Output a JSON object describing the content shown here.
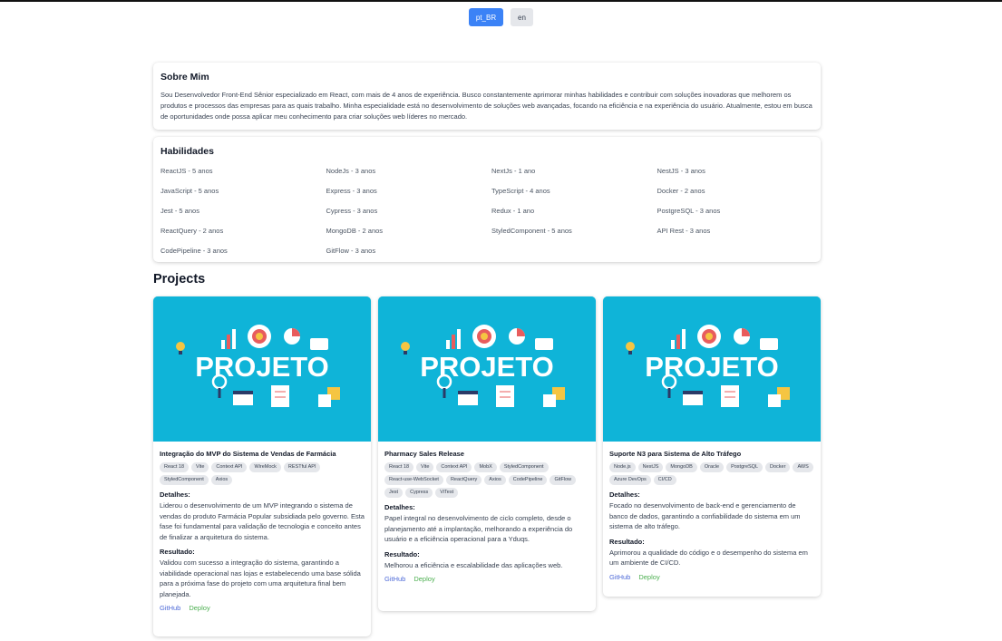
{
  "languages": [
    {
      "label": "pt_BR",
      "active": true
    },
    {
      "label": "en",
      "active": false
    }
  ],
  "about": {
    "title": "Sobre Mim",
    "text": "Sou Desenvolvedor Front-End Sênior especializado em React, com mais de 4 anos de experiência. Busco constantemente aprimorar minhas habilidades e contribuir com soluções inovadoras que melhorem os produtos e processos das empresas para as quais trabalho. Minha especialidade está no desenvolvimento de soluções web avançadas, focando na eficiência e na experiência do usuário. Atualmente, estou em busca de oportunidades onde possa aplicar meu conhecimento para criar soluções web líderes no mercado."
  },
  "skills": {
    "title": "Habilidades",
    "items": [
      "ReactJS - 5 anos",
      "NodeJs - 3 anos",
      "NextJs - 1 ano",
      "NestJS - 3 anos",
      "JavaScript - 5 anos",
      "Express - 3 anos",
      "TypeScript - 4 anos",
      "Docker - 2 anos",
      "Jest - 5 anos",
      "Cypress - 3 anos",
      "Redux - 1 ano",
      "PostgreSQL - 3 anos",
      "ReactQuery - 2 anos",
      "MongoDB - 2 anos",
      "StyledComponent - 5 anos",
      "API Rest - 3 anos",
      "CodePipeline - 3 anos",
      "GitFlow - 3 anos"
    ]
  },
  "projects": {
    "title": "Projects",
    "image_text": "PROJETO",
    "details_label": "Detalhes:",
    "result_label": "Resultado:",
    "github_label": "GitHub",
    "deploy_label": "Deploy",
    "items": [
      {
        "title": "Integração do MVP do Sistema de Vendas de Farmácia",
        "tags": [
          "React 18",
          "Vite",
          "Context API",
          "WireMock",
          "RESTful API",
          "StyledComponent",
          "Axios"
        ],
        "details": "Liderou o desenvolvimento de um MVP integrando o sistema de vendas do produto Farmácia Popular subsidiada pelo governo. Esta fase foi fundamental para validação de tecnologia e conceito antes de finalizar a arquitetura do sistema.",
        "result": "Validou com sucesso a integração do sistema, garantindo a viabilidade operacional nas lojas e estabelecendo uma base sólida para a próxima fase do projeto com uma arquitetura final bem planejada."
      },
      {
        "title": "Pharmacy Sales Release",
        "tags": [
          "React 18",
          "Vite",
          "Context API",
          "MobX",
          "StyledComponent",
          "React-use-WebSocket",
          "ReactQuery",
          "Axios",
          "CodePipeline",
          "GitFlow",
          "Jest",
          "Cypress",
          "ViTest"
        ],
        "details": "Papel integral no desenvolvimento de ciclo completo, desde o planejamento até a implantação, melhorando a experiência do usuário e a eficiência operacional para a Yduqs.",
        "result": "Melhorou a eficiência e escalabilidade das aplicações web."
      },
      {
        "title": "Suporte N3 para Sistema de Alto Tráfego",
        "tags": [
          "Node.js",
          "NestJS",
          "MongoDB",
          "Oracle",
          "PostgreSQL",
          "Docker",
          "AWS",
          "Azure DevOps",
          "CI/CD"
        ],
        "details": "Focado no desenvolvimento de back-end e gerenciamento de banco de dados, garantindo a confiabilidade do sistema em um sistema de alto tráfego.",
        "result": "Aprimorou a qualidade do código e o desempenho do sistema em um ambiente de CI/CD."
      }
    ]
  },
  "colors": {
    "accent": "#3b82f6",
    "project_image_bg": "#0fb4d8",
    "github_link": "#4f6bd8",
    "deploy_link": "#4caf50"
  }
}
